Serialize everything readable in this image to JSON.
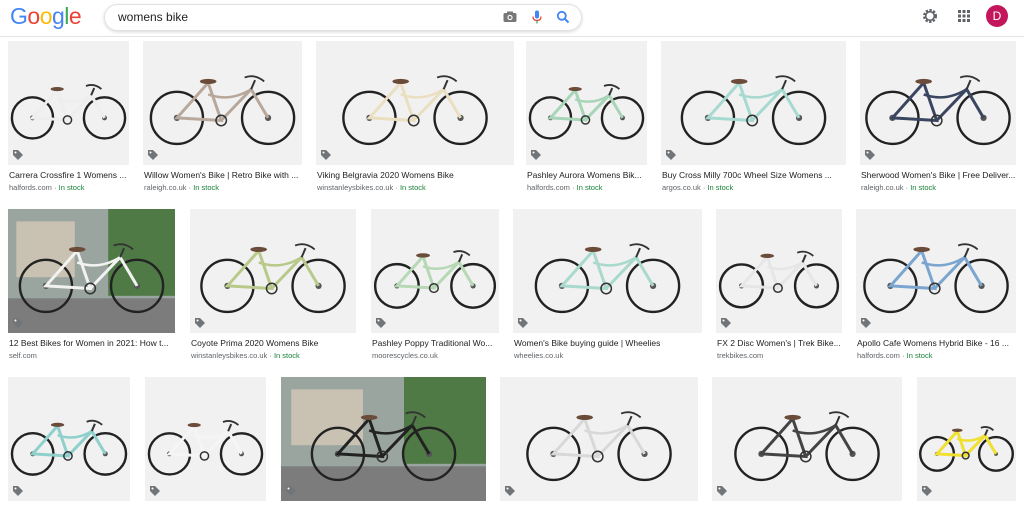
{
  "header": {
    "logo": [
      "G",
      "o",
      "o",
      "g",
      "l",
      "e"
    ],
    "logo_colors": [
      "#4285F4",
      "#EA4335",
      "#FBBC05",
      "#4285F4",
      "#34A853",
      "#EA4335"
    ],
    "query": "womens bike",
    "avatar_letter": "D"
  },
  "results": [
    {
      "caption": "Carrera Crossfire 1 Womens ...",
      "source": "halfords.com",
      "stock": "In stock",
      "frame": "#eeeeee"
    },
    {
      "caption": "Willow Women's Bike | Retro Bike with ...",
      "source": "raleigh.co.uk",
      "stock": "In stock",
      "frame": "#b8a89c"
    },
    {
      "caption": "Viking Belgravia 2020 Womens Bike",
      "source": "winstanleysbikes.co.uk",
      "stock": "In stock",
      "frame": "#eadfc0"
    },
    {
      "caption": "Pashley Aurora Womens Bik...",
      "source": "halfords.com",
      "stock": "In stock",
      "frame": "#a8d4b8"
    },
    {
      "caption": "Buy Cross Milly 700c Wheel Size Womens ...",
      "source": "argos.co.uk",
      "stock": "In stock",
      "frame": "#a6d9d0"
    },
    {
      "caption": "Sherwood Women's Bike | Free Deliver...",
      "source": "raleigh.co.uk",
      "stock": "In stock",
      "frame": "#3a4560"
    },
    {
      "caption": "12 Best Bikes for Women in 2021: How t...",
      "source": "self.com",
      "stock": "",
      "frame": "#f2f2f2"
    },
    {
      "caption": "Coyote Prima 2020 Womens Bike",
      "source": "winstanleysbikes.co.uk",
      "stock": "In stock",
      "frame": "#b8c98a"
    },
    {
      "caption": "Pashley Poppy Traditional Wo...",
      "source": "moorescycles.co.uk",
      "stock": "",
      "frame": "#b6d8b4"
    },
    {
      "caption": "Women's Bike buying guide | Wheelies",
      "source": "wheelies.co.uk",
      "stock": "",
      "frame": "#a8d9cc"
    },
    {
      "caption": "FX 2 Disc Women's | Trek Bike...",
      "source": "trekbikes.com",
      "stock": "",
      "frame": "#e6e6e6"
    },
    {
      "caption": "Apollo Cafe Womens Hybrid Bike - 16 ...",
      "source": "halfords.com",
      "stock": "In stock",
      "frame": "#7aa5cf"
    },
    {
      "caption": "",
      "source": "",
      "stock": "",
      "frame": "#8fd0cc"
    },
    {
      "caption": "",
      "source": "",
      "stock": "",
      "frame": "#f5f5f5"
    },
    {
      "caption": "",
      "source": "",
      "stock": "",
      "frame": "#222222"
    },
    {
      "caption": "",
      "source": "",
      "stock": "",
      "frame": "#d8d8d8"
    },
    {
      "caption": "",
      "source": "",
      "stock": "",
      "frame": "#444444"
    },
    {
      "caption": "",
      "source": "",
      "stock": "",
      "frame": "#f0e030"
    }
  ]
}
